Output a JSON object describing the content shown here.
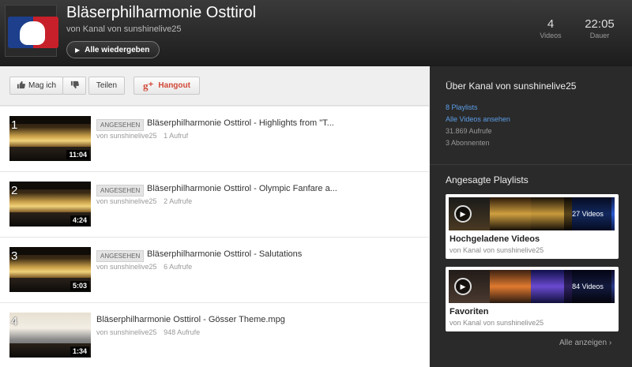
{
  "header": {
    "title": "Bläserphilharmonie Osttirol",
    "subtitle": "von Kanal von sunshinelive25",
    "play_all_label": "Alle wiedergeben",
    "stats": {
      "videos_value": "4",
      "videos_label": "Videos",
      "duration_value": "22:05",
      "duration_label": "Dauer"
    }
  },
  "toolbar": {
    "like_label": "Mag ich",
    "share_label": "Teilen",
    "hangout_label": "Hangout"
  },
  "videos": [
    {
      "index": "1",
      "badge": "ANGESEHEN",
      "title": "Bläserphilharmonie Osttirol - Highlights from \"T...",
      "author": "von sunshinelive25",
      "views": "1 Aufruf",
      "duration": "11:04"
    },
    {
      "index": "2",
      "badge": "ANGESEHEN",
      "title": "Bläserphilharmonie Osttirol - Olympic Fanfare a...",
      "author": "von sunshinelive25",
      "views": "2 Aufrufe",
      "duration": "4:24"
    },
    {
      "index": "3",
      "badge": "ANGESEHEN",
      "title": "Bläserphilharmonie Osttirol - Salutations",
      "author": "von sunshinelive25",
      "views": "6 Aufrufe",
      "duration": "5:03"
    },
    {
      "index": "4",
      "badge": "",
      "title": "Bläserphilharmonie Osttirol - Gösser Theme.mpg",
      "author": "von sunshinelive25",
      "views": "948 Aufrufe",
      "duration": "1:34"
    }
  ],
  "sidebar": {
    "about_heading": "Über Kanal von sunshinelive25",
    "playlists_link": "8 Playlists",
    "all_videos_link": "Alle Videos ansehen",
    "views": "31.869 Aufrufe",
    "subscribers": "3 Abonnenten",
    "featured_heading": "Angesagte Playlists",
    "playlists": [
      {
        "title": "Hochgeladene Videos",
        "count": "27 Videos",
        "owner": "von Kanal von sunshinelive25"
      },
      {
        "title": "Favoriten",
        "count": "84 Videos",
        "owner": "von Kanal von sunshinelive25"
      }
    ],
    "show_all_label": "Alle anzeigen"
  }
}
